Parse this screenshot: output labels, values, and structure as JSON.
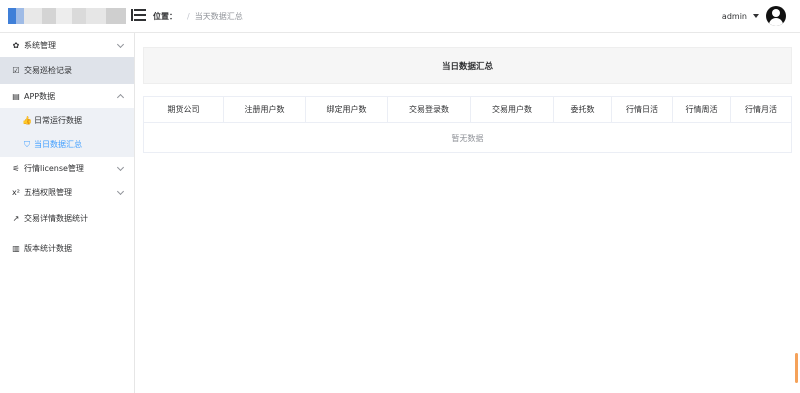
{
  "header": {
    "breadcrumb_label": "位置：",
    "breadcrumb_sep": "/",
    "breadcrumb_current": "当天数据汇总",
    "username": "admin",
    "logo_colors": [
      "#3f7fd8",
      "#b0c4e4",
      "#e4e4e4",
      "#d6d6d6",
      "#eeeeee",
      "#dcdcdc",
      "#e6e6e6",
      "#cfcfcf"
    ]
  },
  "sidebar": {
    "items": [
      {
        "label": "系统管理",
        "icon": "gear-icon"
      },
      {
        "label": "交易巡检记录",
        "icon": "check-square-icon"
      },
      {
        "label": "APP数据",
        "icon": "database-icon"
      },
      {
        "label": "行情license管理",
        "icon": "sliders-icon"
      },
      {
        "label": "五档权限管理",
        "icon": "superscript-icon"
      },
      {
        "label": "交易详情数据统计",
        "icon": "line-chart-icon"
      },
      {
        "label": "版本统计数据",
        "icon": "bar-chart-icon"
      }
    ],
    "sub_items": [
      {
        "label": "日常运行数据",
        "icon": "thumbs-up-icon"
      },
      {
        "label": "当日数据汇总",
        "icon": "shield-icon"
      }
    ]
  },
  "main": {
    "title": "当日数据汇总",
    "columns": [
      "期货公司",
      "注册用户数",
      "绑定用户数",
      "交易登录数",
      "交易用户数",
      "委托数",
      "行情日活",
      "行情周活",
      "行情月活"
    ],
    "empty_text": "暂无数据"
  },
  "colors": {
    "accent": "#409eff",
    "submenu_bg": "#eef1f6",
    "active_group_bg": "#dfe3ea",
    "scroll_thumb": "#f5a25a"
  }
}
